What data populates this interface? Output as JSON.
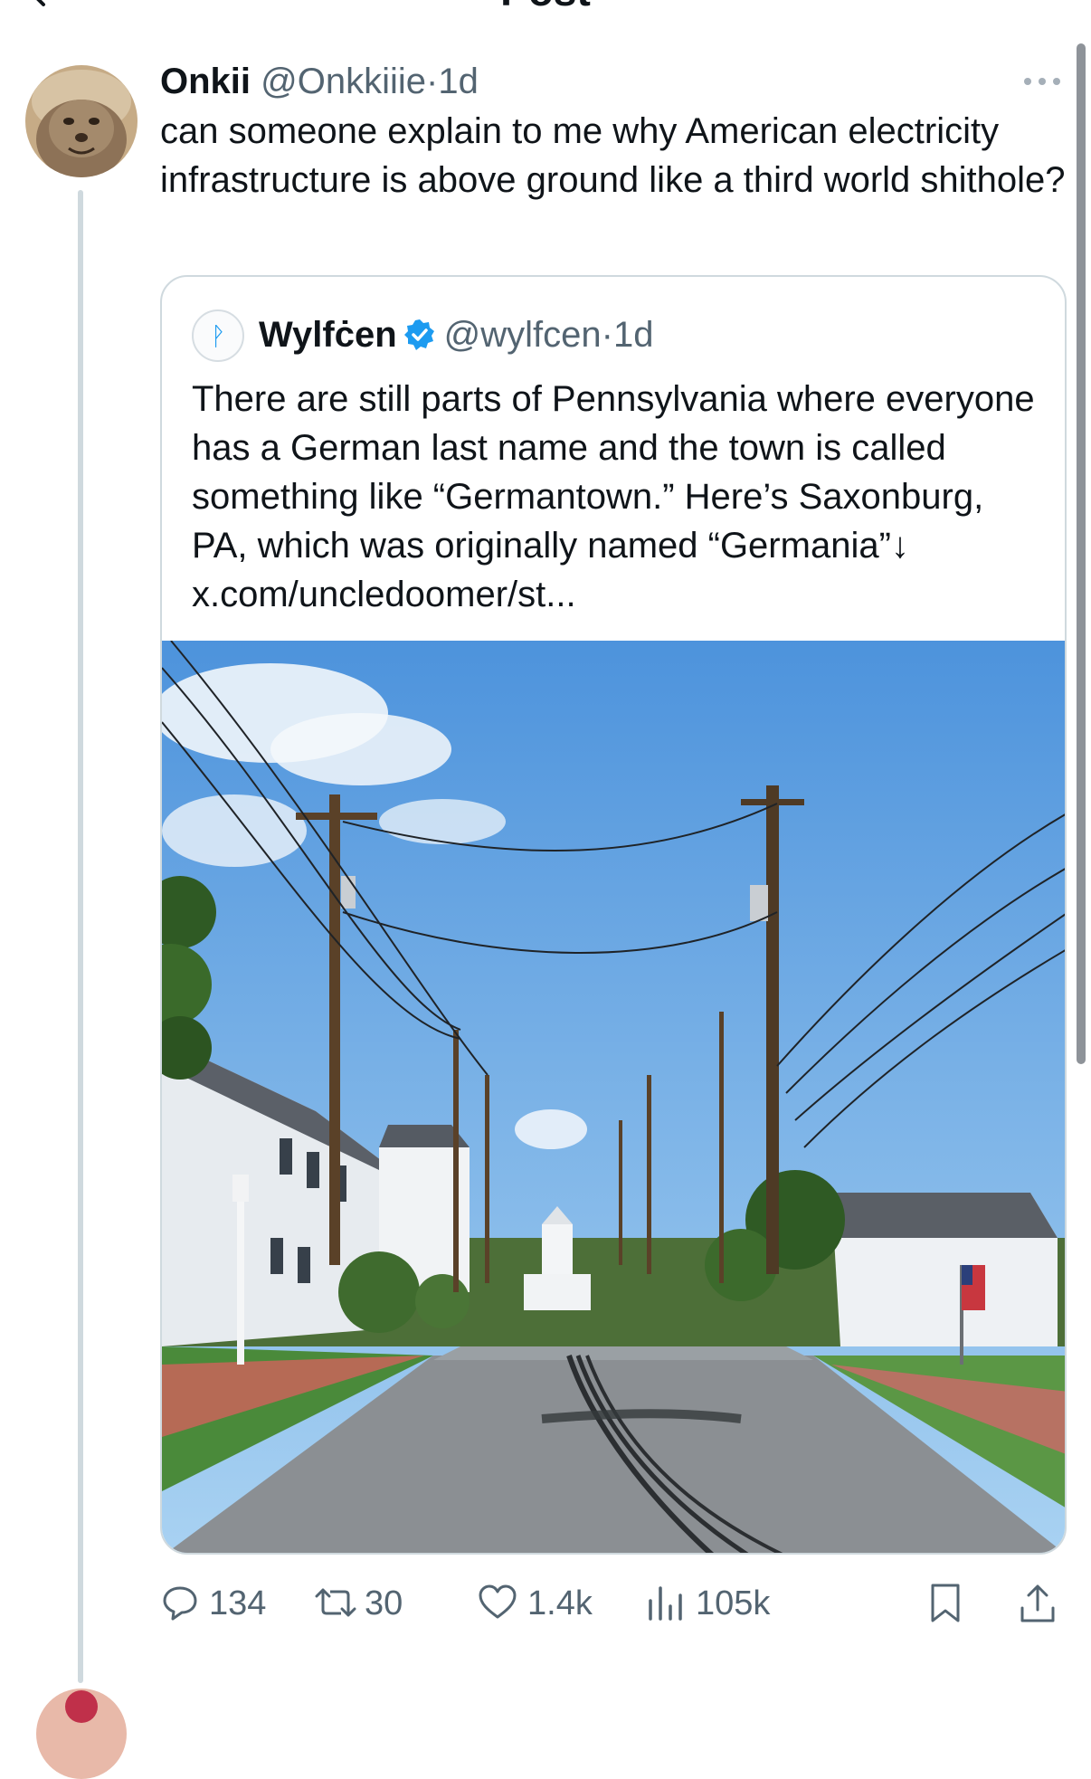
{
  "header": {
    "title": "Post"
  },
  "tweet": {
    "author_name": "Onkii",
    "handle": "@Onkkiiie",
    "separator": "·",
    "time": "1d",
    "text": "can someone explain to me why American electricity infrastructure is above ground like a third world shithole?",
    "avatar_icon": "seal-avatar"
  },
  "quote": {
    "avatar_glyph": "ᚹ",
    "author_name": "Wylfċen",
    "handle": "@wylfcen",
    "separator": "·",
    "time": "1d",
    "text": "There are still parts of Pennsylvania where everyone has a German last name and the town is called something like “Germantown.” Here’s Saxonburg, PA, which was originally named “Germania”↓ x.com/uncledoomer/st...",
    "image_icon": "street-photo"
  },
  "actions": {
    "replies": "134",
    "reposts": "30",
    "likes": "1.4k",
    "views": "105k"
  },
  "colors": {
    "text": "#0f1419",
    "secondary": "#536471",
    "border": "#cfd9de",
    "verified": "#1d9bf0"
  }
}
